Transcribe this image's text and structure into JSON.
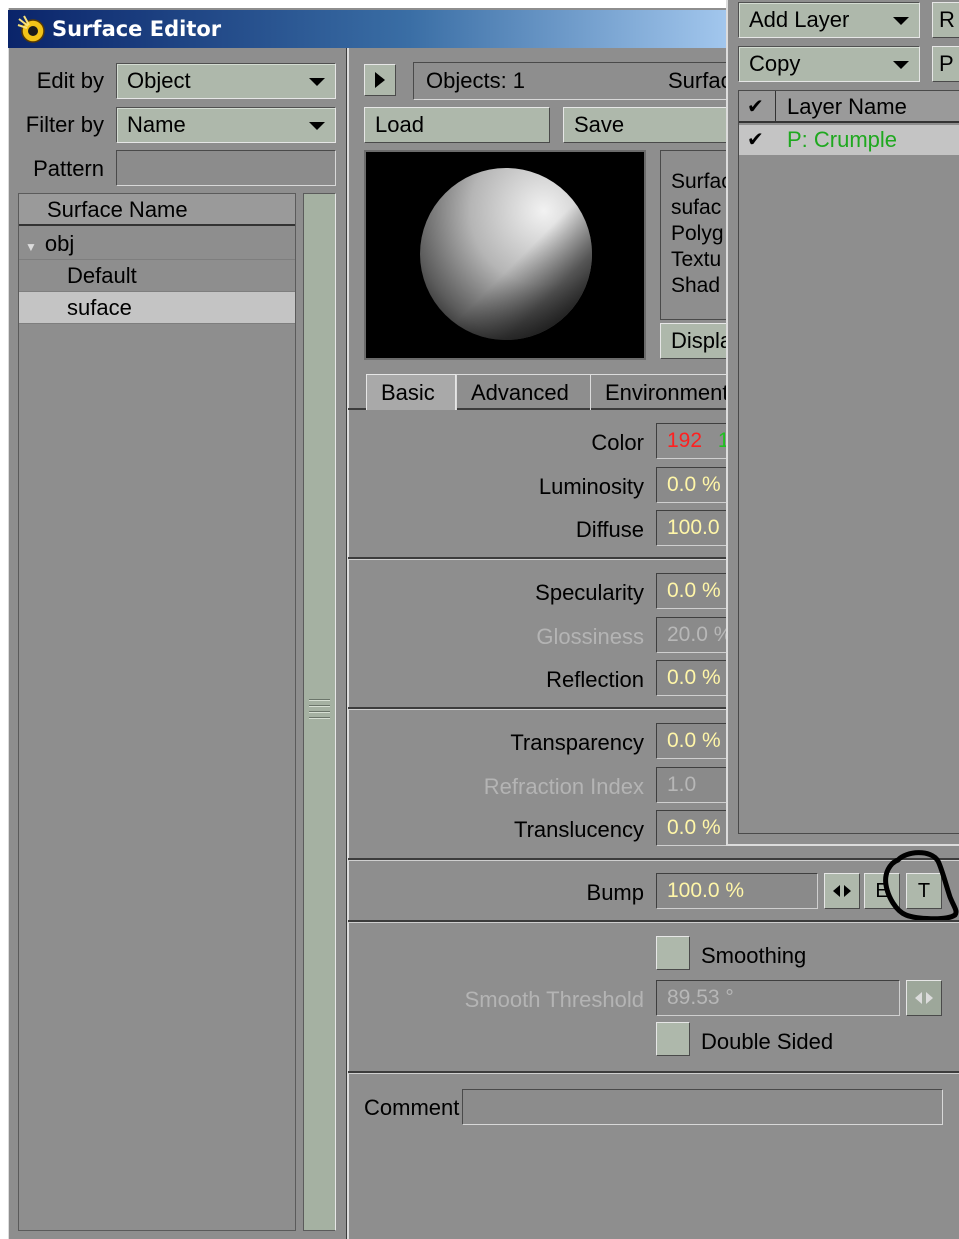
{
  "window": {
    "title": "Surface Editor"
  },
  "left_panel": {
    "edit_by_label": "Edit by",
    "edit_by_value": "Object",
    "filter_by_label": "Filter by",
    "filter_by_value": "Name",
    "pattern_label": "Pattern",
    "pattern_value": "",
    "list_header": "Surface Name",
    "items": [
      {
        "label": "obj",
        "expander": "▼"
      },
      {
        "label": "Default"
      },
      {
        "label": "suface"
      }
    ]
  },
  "top_bar": {
    "objects_label": "Objects: 1",
    "surface_label": "Surfac",
    "load_label": "Load",
    "save_label": "Save"
  },
  "info": {
    "lines": [
      "Surfac",
      "sufac",
      "Polyg",
      "Textu",
      "Shad"
    ],
    "display_label": "Displa"
  },
  "tabs": [
    {
      "label": "Basic",
      "active": true
    },
    {
      "label": "Advanced",
      "active": false
    },
    {
      "label": "Environment",
      "active": false
    }
  ],
  "properties": {
    "color_label": "Color",
    "color_value": "192",
    "color_value_second": "1",
    "luminosity_label": "Luminosity",
    "luminosity_value": "0.0 %",
    "diffuse_label": "Diffuse",
    "diffuse_value": "100.0",
    "specularity_label": "Specularity",
    "specularity_value": "0.0 %",
    "glossiness_label": "Glossiness",
    "glossiness_value": "20.0 %",
    "reflection_label": "Reflection",
    "reflection_value": "0.0 %",
    "transparency_label": "Transparency",
    "transparency_value": "0.0 %",
    "refraction_label": "Refraction Index",
    "refraction_value": "1.0",
    "translucency_label": "Translucency",
    "translucency_value": "0.0 %",
    "bump_label": "Bump",
    "bump_value": "100.0 %",
    "envelope_button": "E",
    "texture_button": "T",
    "smoothing_label": "Smoothing",
    "smooth_threshold_label": "Smooth Threshold",
    "smooth_threshold_value": "89.53 °",
    "double_sided_label": "Double Sided",
    "comment_label": "Comment",
    "comment_value": ""
  },
  "texture_panel": {
    "add_layer_label": "Add Layer",
    "copy_label": "Copy",
    "button_r": "R",
    "button_p": "P",
    "column_header": "Layer Name",
    "check_glyph": "✔",
    "layers": [
      {
        "name": "P: Crumple",
        "enabled": true
      }
    ]
  },
  "colors": {
    "panel": "#8e8e8e",
    "button": "#aeb8ab",
    "value_text": "#fff6a8",
    "red_channel": "#ff2020",
    "green_channel": "#20c020",
    "layer_name_green": "#1fa81f",
    "annotation_circle": "#000000"
  }
}
